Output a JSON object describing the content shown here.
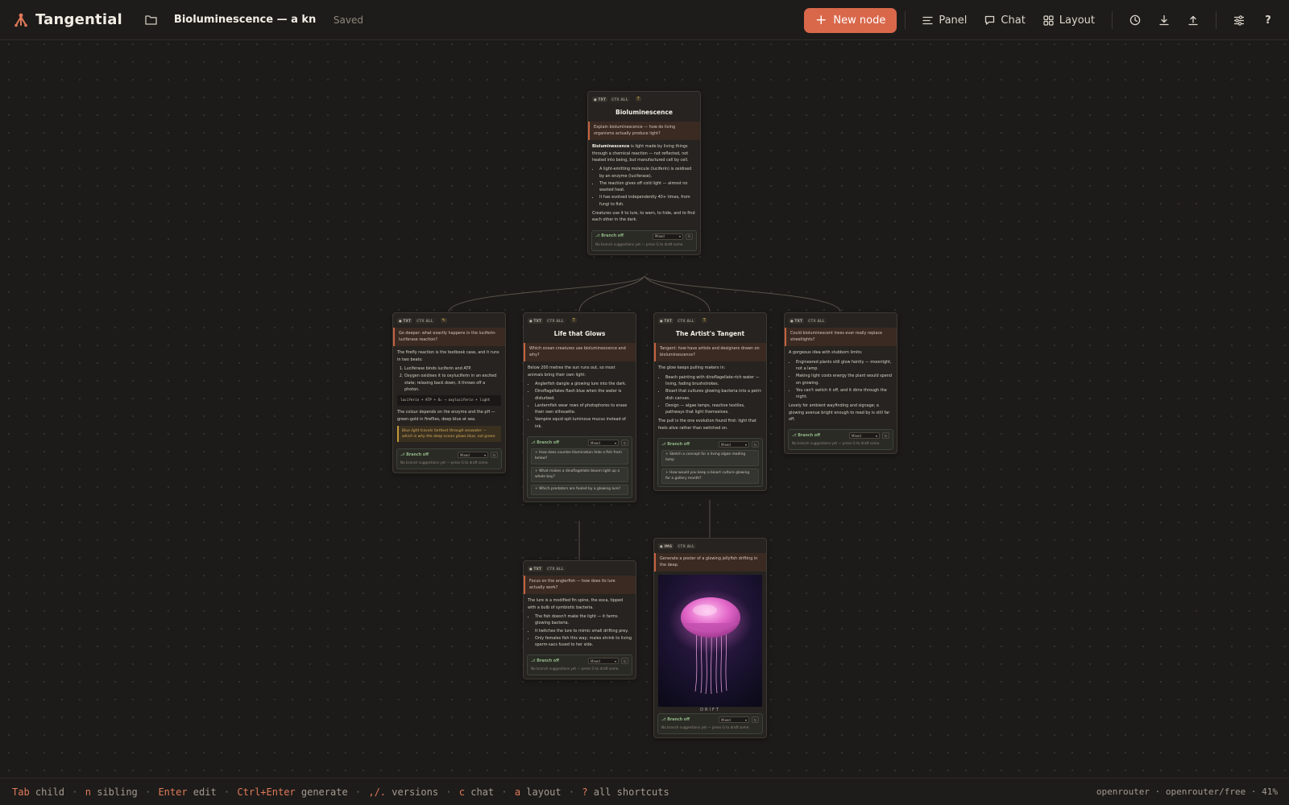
{
  "app": {
    "name": "Tangential"
  },
  "doc": {
    "title": "Bioluminescence — a kn",
    "status": "Saved"
  },
  "toolbar": {
    "new_node": "New node",
    "panel": "Panel",
    "chat": "Chat",
    "layout": "Layout",
    "help": "?"
  },
  "colors": {
    "accent": "#d9684b",
    "canvas": "#1d1b19",
    "branch_green": "#8fb685",
    "callout_gold": "#c49a3a"
  },
  "labels": {
    "txt": "● TXT",
    "img": "● IMG",
    "ctx": "CTX ALL",
    "branch": "⎇ Branch off",
    "model": "Mixed",
    "empty": "No branch suggestions yet — press G to draft some."
  },
  "nodes": {
    "root": {
      "title": "Bioluminescence",
      "prompt": "Explain bioluminescence — how do living organisms actually produce light?",
      "p1_lead": "Bioluminescence",
      "p1_rest": " is light made by living things through a chemical reaction — not reflected, not heated into being, but manufactured cell by cell.",
      "b1": "A light-emitting molecule (luciferin) is oxidised by an enzyme (luciferase).",
      "b2": "The reaction gives off cold light — almost no wasted heat.",
      "b3": "It has evolved independently 40+ times, from fungi to fish.",
      "p2": "Creatures use it to lure, to warn, to hide, and to find each other in the dark."
    },
    "deeper": {
      "prompt": "Go deeper: what exactly happens in the luciferin-luciferase reaction?",
      "p1": "The firefly reaction is the textbook case, and it runs in two beats:",
      "s1": "Luciferase binds luciferin and ATP.",
      "s2": "Oxygen oxidises it to oxyluciferin in an excited state; relaxing back down, it throws off a photon.",
      "code": "luciferin + ATP + O₂ → oxyluciferin + light",
      "p2": "The colour depends on the enzyme and the pH — green-gold in fireflies, deep blue at sea.",
      "callout": "Blue light travels farthest through seawater — which is why the deep ocean glows blue, not green."
    },
    "life": {
      "title": "Life that Glows",
      "prompt": "Which ocean creatures use bioluminescence and why?",
      "p1": "Below 200 metres the sun runs out, so most animals bring their own light:",
      "b1": "Anglerfish dangle a glowing lure into the dark.",
      "b2": "Dinoflagellates flash blue when the water is disturbed.",
      "b3": "Lanternfish wear rows of photophores to erase their own silhouette.",
      "b4": "Vampire squid spit luminous mucus instead of ink.",
      "s1": "How does counter-illumination hide a fish from below?",
      "s2": "What makes a dinoflagellate bloom light up a whole bay?",
      "s3": "Which predators are fooled by a glowing lure?"
    },
    "artist": {
      "title": "The Artist's Tangent",
      "prompt": "Tangent: how have artists and designers drawn on bioluminescence?",
      "p1": "The glow keeps pulling makers in:",
      "b1": "Beach painting with dinoflagellate-rich water — living, fading brushstrokes.",
      "b2": "Bioart that cultures glowing bacteria into a petri-dish canvas.",
      "b3": "Design — algae lamps, reactive textiles, pathways that light themselves.",
      "p2": "The pull is the one evolution found first: light that feels alive rather than switched on.",
      "s1": "Sketch a concept for a living algae reading lamp",
      "s2": "How would you keep a bioart culture glowing for a gallery month?"
    },
    "streetlights": {
      "prompt": "Could bioluminescent trees ever really replace streetlights?",
      "p1": "A gorgeous idea with stubborn limits:",
      "b1": "Engineered plants still glow faintly — moonlight, not a lamp.",
      "b2": "Making light costs energy the plant would spend on growing.",
      "b3": "You can't switch it off, and it dims through the night.",
      "p2": "Lovely for ambient wayfinding and signage; a glowing avenue bright enough to read by is still far off."
    },
    "angler": {
      "prompt": "Focus on the anglerfish — how does its lure actually work?",
      "p1": "The lure is a modified fin spine, the esca, tipped with a bulb of symbiotic bacteria.",
      "b1": "The fish doesn't make the light — it farms glowing bacteria.",
      "b2": "It twitches the lure to mimic small drifting prey.",
      "b3": "Only females fish this way; males shrink to living sperm-sacs fused to her side."
    },
    "poster": {
      "prompt": "Generate a poster of a glowing jellyfish drifting in the deep.",
      "caption": "DRIFT"
    }
  },
  "statusbar": {
    "k1": "Tab",
    "t1": " child",
    "k2": "n",
    "t2": " sibling",
    "k3": "Enter",
    "t3": " edit",
    "k4": "Ctrl+Enter",
    "t4": " generate",
    "k5": ",/.",
    "t5": " versions",
    "k6": "c",
    "t6": " chat",
    "k7": "a",
    "t7": " layout",
    "k8": "?",
    "t8": " all shortcuts",
    "right": "openrouter · openrouter/free · 41%"
  }
}
